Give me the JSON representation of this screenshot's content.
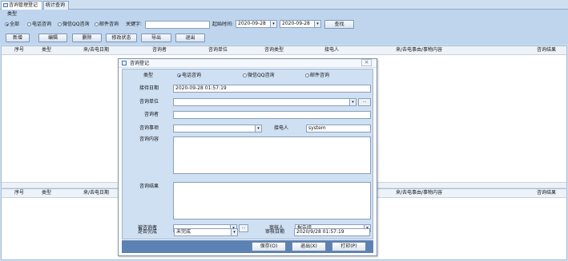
{
  "tabs": [
    {
      "label": "咨询管理登记"
    },
    {
      "label": "统计查询"
    }
  ],
  "filter": {
    "type_label": "类型",
    "radios": [
      {
        "label": "全部",
        "checked": true
      },
      {
        "label": "电话咨询",
        "checked": false
      },
      {
        "label": "微信QQ咨询",
        "checked": false
      },
      {
        "label": "邮件咨询",
        "checked": false
      }
    ],
    "keyword_label": "关键字:",
    "keyword_value": "",
    "start_time_label": "起始时间:",
    "start_date": "2020-09-28",
    "end_date": "2020-09-28",
    "search_label": "查找"
  },
  "toolbar": {
    "add": "新增",
    "edit": "编辑",
    "delete": "删除",
    "modify_status": "修改状态",
    "export": "导出",
    "exit": "退出"
  },
  "grid_columns": [
    "序号",
    "类型",
    "来/去电日期",
    "咨询者",
    "咨询单位",
    "咨询类型",
    "接电人",
    "来/去电事由/事物内容",
    "咨询结果"
  ],
  "dialog": {
    "title": "咨询登记",
    "type_label": "类型",
    "type_options": [
      {
        "label": "电话咨询",
        "checked": true
      },
      {
        "label": "微信QQ咨询",
        "checked": false
      },
      {
        "label": "邮件咨询",
        "checked": false
      }
    ],
    "reception_date_label": "接待日期",
    "reception_date": "2020-09-28 01:57:19",
    "unit_label": "咨询单位",
    "unit_value": "",
    "ellipsis": "...",
    "consultant_label": "咨询者",
    "consultant_value": "",
    "matter_label": "咨询事项",
    "matter_value": "",
    "receiver_label": "接电人",
    "receiver_value": "system",
    "content_label": "咨询内容",
    "result_label": "咨询结果",
    "consulted_label": "被咨询者",
    "consulted_value": "",
    "reviewer_label": "审核人",
    "reviewer_value": "报告组",
    "completed_label": "是否完成",
    "completed_value": "未完成",
    "review_date_label": "审核日期",
    "review_date": "2020/9/28 01:57:19",
    "save": "保存(O)",
    "exit": "退出(X)",
    "print": "打印(P)"
  }
}
